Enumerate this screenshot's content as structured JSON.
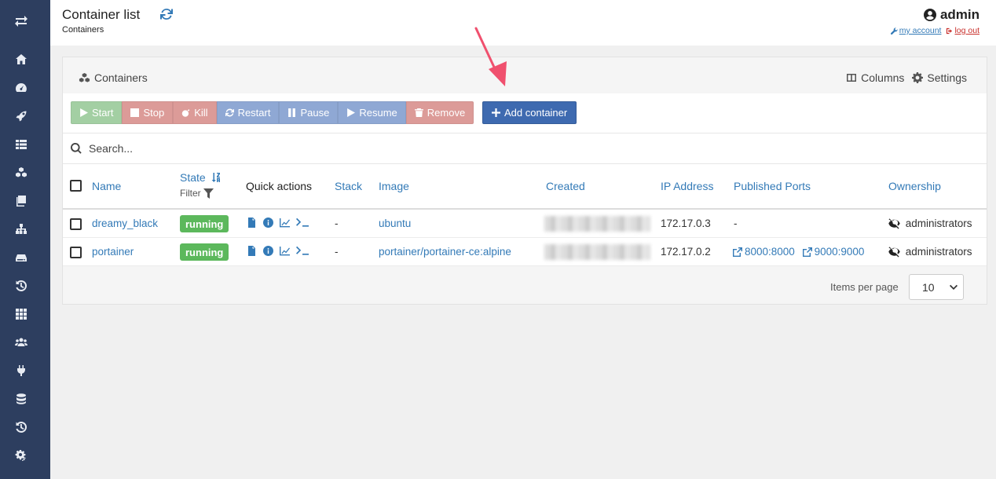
{
  "header": {
    "title": "Container list",
    "breadcrumb": "Containers",
    "user": "admin",
    "my_account": "my account",
    "log_out": "log out"
  },
  "panel": {
    "title": "Containers",
    "columns_label": "Columns",
    "settings_label": "Settings"
  },
  "actions": {
    "start": "Start",
    "stop": "Stop",
    "kill": "Kill",
    "restart": "Restart",
    "pause": "Pause",
    "resume": "Resume",
    "remove": "Remove",
    "add": "Add container"
  },
  "search": {
    "placeholder": "Search..."
  },
  "table": {
    "headers": {
      "name": "Name",
      "state": "State",
      "filter": "Filter",
      "quick_actions": "Quick actions",
      "stack": "Stack",
      "image": "Image",
      "created": "Created",
      "ip": "IP Address",
      "ports": "Published Ports",
      "ownership": "Ownership"
    },
    "rows": [
      {
        "name": "dreamy_black",
        "state": "running",
        "stack": "-",
        "image": "ubuntu",
        "ip": "172.17.0.3",
        "ports": [
          "-"
        ],
        "ownership": "administrators"
      },
      {
        "name": "portainer",
        "state": "running",
        "stack": "-",
        "image": "portainer/portainer-ce:alpine",
        "ip": "172.17.0.2",
        "ports": [
          "8000:8000",
          "9000:9000"
        ],
        "ownership": "administrators"
      }
    ]
  },
  "pagination": {
    "label": "Items per page",
    "value": "10"
  },
  "colors": {
    "sidebar": "#2d3e5f",
    "link": "#337ab7",
    "running": "#5cb85c",
    "add_button": "#3e6ab0",
    "annotation": "#f0506e"
  },
  "icons": {
    "sidebar": [
      "logo-arrows-icon",
      "home-icon",
      "dashboard-icon",
      "rocket-icon",
      "templates-icon",
      "containers-icon",
      "images-icon",
      "networks-icon",
      "volumes-icon",
      "events-icon",
      "host-icon",
      "users-icon",
      "endpoints-icon",
      "registries-icon",
      "activity-icon",
      "settings-icon"
    ]
  }
}
